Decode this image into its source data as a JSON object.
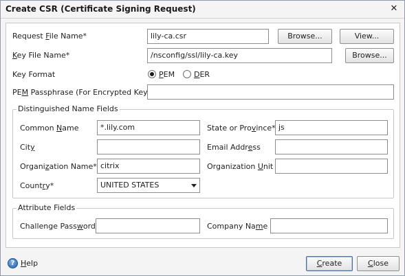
{
  "dialog": {
    "title": "Create CSR (Certificate Signing Request)",
    "close_glyph": "✕"
  },
  "request_file": {
    "label_pre": "Request ",
    "label_mnemonic": "F",
    "label_post": "ile Name*",
    "value": "lily-ca.csr",
    "browse_label": "Browse...",
    "view_label": "View..."
  },
  "key_file": {
    "label_mnemonic": "K",
    "label_post": "ey File Name*",
    "value": "/nsconfig/ssl/lily-ca.key",
    "browse_label": "Browse..."
  },
  "key_format": {
    "label": "Key Format",
    "options": [
      {
        "mnemonic": "P",
        "rest": "EM",
        "selected": true
      },
      {
        "mnemonic": "D",
        "rest": "ER",
        "selected": false
      }
    ]
  },
  "passphrase": {
    "label_pre": "PE",
    "label_mnemonic": "M",
    "label_post": " Passphrase (For Encrypted Key)",
    "value": ""
  },
  "dn": {
    "legend": "Distinguished Name Fields",
    "common_name": {
      "label_pre": "Common ",
      "label_mnemonic": "N",
      "label_post": "ame",
      "value": "*.lily.com"
    },
    "state": {
      "label_pre": "State or Pro",
      "label_mnemonic": "v",
      "label_post": "ince*",
      "value": "js"
    },
    "city": {
      "label_pre": "Cit",
      "label_mnemonic": "y",
      "label_post": "",
      "value": ""
    },
    "email": {
      "label_pre": "Email Addr",
      "label_mnemonic": "e",
      "label_post": "ss",
      "value": ""
    },
    "org_name": {
      "label_pre": "Organi",
      "label_mnemonic": "z",
      "label_post": "ation Name*",
      "value": "citrix"
    },
    "org_unit": {
      "label_pre": "Organization ",
      "label_mnemonic": "U",
      "label_post": "nit",
      "value": ""
    },
    "country": {
      "label_pre": "Count",
      "label_mnemonic": "r",
      "label_post": "y*",
      "value": "UNITED STATES"
    }
  },
  "attr": {
    "legend": "Attribute Fields",
    "challenge": {
      "label_pre": "Challenge Pass",
      "label_mnemonic": "w",
      "label_post": "ord",
      "value": ""
    },
    "company": {
      "label_pre": "Company Na",
      "label_mnemonic": "m",
      "label_post": "e",
      "value": ""
    }
  },
  "footer": {
    "help_glyph": "?",
    "help_mnemonic": "H",
    "help_rest": "elp",
    "create_mnemonic": "C",
    "create_rest": "reate",
    "close_mnemonic": "C",
    "close_rest": "lose"
  },
  "colors": {
    "titlebar": "#f4f4f4",
    "panel": "#ffffff",
    "primary_border": "#4e6d9f"
  }
}
